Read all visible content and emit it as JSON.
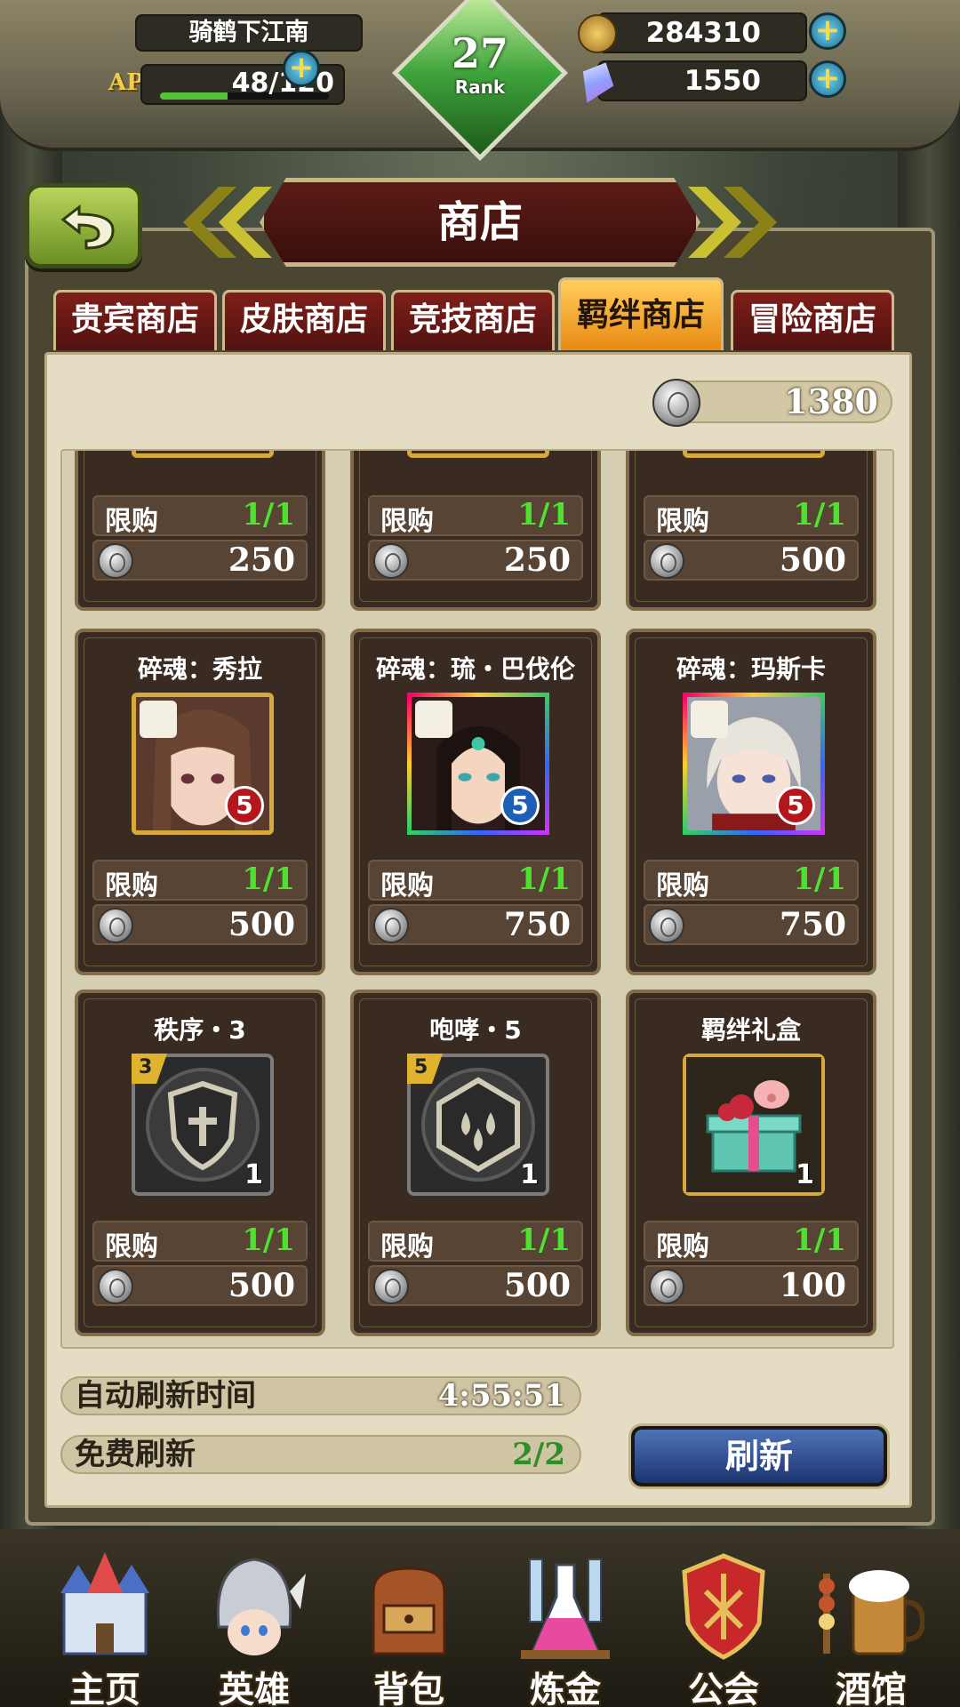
{
  "hud": {
    "player_name": "骑鹤下江南",
    "ap_icon_text": "AP",
    "ap_text": "48/120",
    "ap_fraction": 0.4,
    "rank_number": "27",
    "rank_label": "Rank",
    "gold": "284310",
    "crystals": "1550",
    "plus_symbol": "+"
  },
  "title": "商店",
  "tabs": [
    {
      "label": "贵宾商店",
      "active": false
    },
    {
      "label": "皮肤商店",
      "active": false
    },
    {
      "label": "竞技商店",
      "active": false
    },
    {
      "label": "羁绊商店",
      "active": true
    },
    {
      "label": "冒险商店",
      "active": false
    }
  ],
  "currency_balance": "1380",
  "limit_label": "限购",
  "items": [
    {
      "title": "",
      "limit": "1/1",
      "price": "250"
    },
    {
      "title": "",
      "limit": "1/1",
      "price": "250"
    },
    {
      "title": "",
      "limit": "1/1",
      "price": "500"
    },
    {
      "title": "碎魂：秀拉",
      "limit": "1/1",
      "price": "500",
      "star": "5"
    },
    {
      "title": "碎魂：琉・巴伐伦",
      "limit": "1/1",
      "price": "750",
      "star": "5"
    },
    {
      "title": "碎魂：玛斯卡",
      "limit": "1/1",
      "price": "750",
      "star": "5"
    },
    {
      "title": "秩序・3",
      "limit": "1/1",
      "price": "500",
      "level": "3",
      "qty": "1"
    },
    {
      "title": "咆哮・5",
      "limit": "1/1",
      "price": "500",
      "level": "5",
      "qty": "1"
    },
    {
      "title": "羁绊礼盒",
      "limit": "1/1",
      "price": "100",
      "qty": "1"
    }
  ],
  "auto_refresh_label": "自动刷新时间",
  "auto_refresh_time": "4:55:51",
  "free_refresh_label": "免费刷新",
  "free_refresh_count": "2/2",
  "refresh_button": "刷新",
  "nav": [
    {
      "label": "主页",
      "icon": "castle-icon"
    },
    {
      "label": "英雄",
      "icon": "knight-helmet-icon"
    },
    {
      "label": "背包",
      "icon": "backpack-icon"
    },
    {
      "label": "炼金",
      "icon": "potion-icon"
    },
    {
      "label": "公会",
      "icon": "guild-shield-icon"
    },
    {
      "label": "酒馆",
      "icon": "tavern-beer-icon"
    }
  ],
  "colors": {
    "accent_green": "#4fe12f",
    "tab_active": "#f2a420",
    "tab_inactive": "#6e1a16"
  }
}
